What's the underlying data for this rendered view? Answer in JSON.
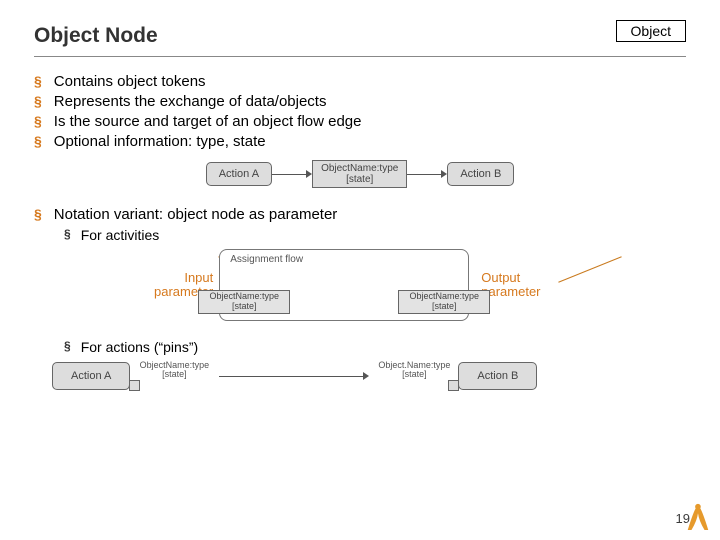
{
  "header": {
    "title": "Object Node",
    "object_label": "Object"
  },
  "bullets": {
    "b1": "Contains object tokens",
    "b2": "Represents the exchange of data/objects",
    "b3": "Is the source and target of an object flow edge",
    "b4": "Optional information: type, state",
    "b5": "Notation variant: object node as parameter",
    "s1": "For activities",
    "s2": "For actions (“pins”)"
  },
  "labels": {
    "input_param": "Input\nparameter",
    "output_param": "Output\nparameter"
  },
  "diagram1": {
    "actionA": "Action A",
    "objLine1": "ObjectName:type",
    "objLine2": "[state]",
    "actionB": "Action B"
  },
  "diagram2": {
    "assignment_title": "Assignment flow",
    "pinL1": "ObjectName:type",
    "pinL2": "[state]",
    "pinR1": "ObjectName:type",
    "pinR2": "[state]"
  },
  "diagram3": {
    "actionA": "Action A",
    "lblA1": "ObjectName:type",
    "lblA2": "[state]",
    "lblB1": "Object.Name:type",
    "lblB2": "[state]",
    "actionB": "Action B"
  },
  "page_number": "19"
}
